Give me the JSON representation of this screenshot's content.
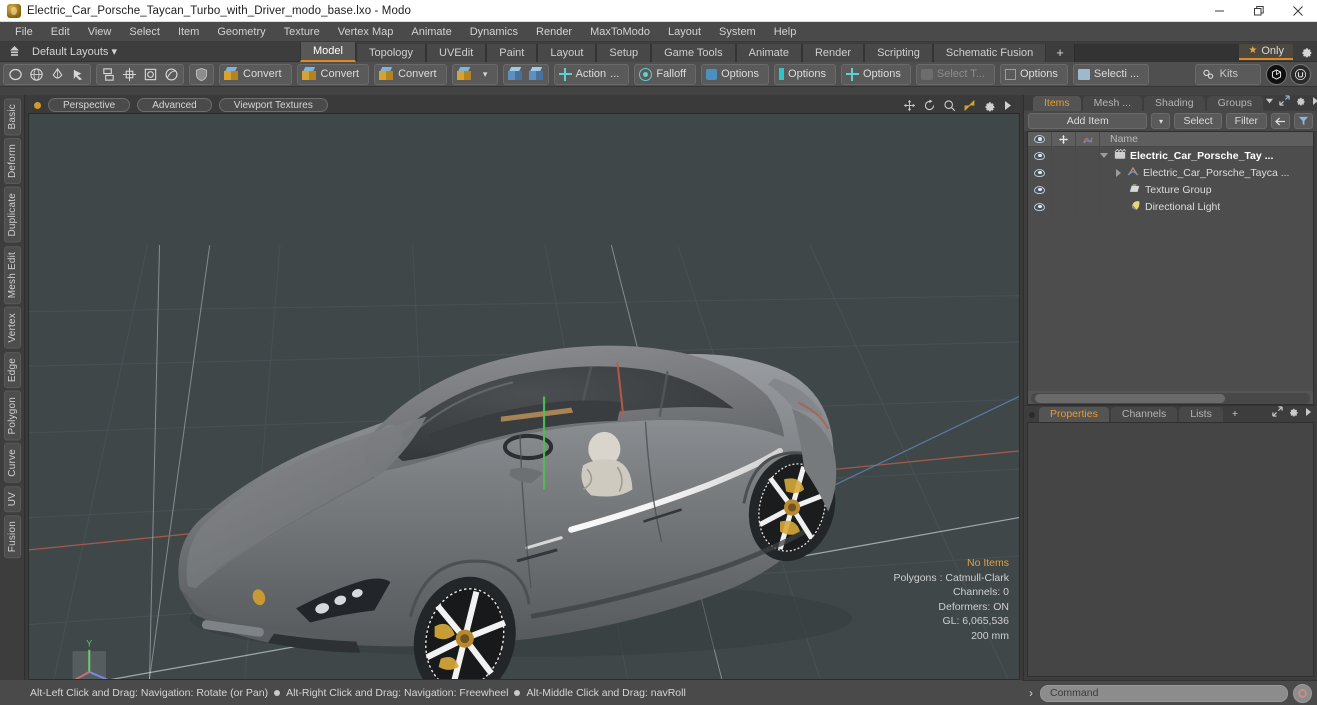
{
  "window": {
    "title": "Electric_Car_Porsche_Taycan_Turbo_with_Driver_modo_base.lxo - Modo",
    "app_icon": "modo-app-icon",
    "minimize": "—",
    "maximize": "❐",
    "close": "✕"
  },
  "menubar": {
    "items": [
      {
        "label": "File"
      },
      {
        "label": "Edit"
      },
      {
        "label": "View"
      },
      {
        "label": "Select"
      },
      {
        "label": "Item"
      },
      {
        "label": "Geometry"
      },
      {
        "label": "Texture"
      },
      {
        "label": "Vertex Map"
      },
      {
        "label": "Animate"
      },
      {
        "label": "Dynamics"
      },
      {
        "label": "Render"
      },
      {
        "label": "MaxToModo"
      },
      {
        "label": "Layout"
      },
      {
        "label": "System"
      },
      {
        "label": "Help"
      }
    ]
  },
  "layoutbar": {
    "home_icon": "home-layout-icon",
    "dropdown_label": "Default Layouts",
    "dropdown_caret": "▾",
    "tabs": [
      {
        "label": "Model",
        "active": true
      },
      {
        "label": "Topology",
        "active": false
      },
      {
        "label": "UVEdit",
        "active": false
      },
      {
        "label": "Paint",
        "active": false
      },
      {
        "label": "Layout",
        "active": false
      },
      {
        "label": "Setup",
        "active": false
      },
      {
        "label": "Game Tools",
        "active": false
      },
      {
        "label": "Animate",
        "active": false
      },
      {
        "label": "Render",
        "active": false
      },
      {
        "label": "Scripting",
        "active": false
      },
      {
        "label": "Schematic Fusion",
        "active": false
      }
    ],
    "add_tab": "+",
    "only_label": "Only",
    "only_star": "★",
    "settings_icon": "gear-icon"
  },
  "toolbar": {
    "primitives": [
      {
        "name": "ellipsoid-tool"
      },
      {
        "name": "sphere-tool"
      },
      {
        "name": "teardrop-tool"
      },
      {
        "name": "pen-tool"
      }
    ],
    "mesh_ops": [
      {
        "name": "duplicate-tool"
      },
      {
        "name": "mirror-tool"
      },
      {
        "name": "bevel-tool"
      },
      {
        "name": "smooth-tool"
      }
    ],
    "shield_icon": "shield-icon",
    "convert_buttons": [
      {
        "label": "Convert",
        "name": "convert-mesh-button"
      },
      {
        "label": "Convert",
        "name": "convert-static-mesh-button"
      },
      {
        "label": "Convert",
        "name": "convert-procedural-button"
      }
    ],
    "convert_dropdown_caret": "▾",
    "action_label": "Action",
    "action_ellipsis": "...",
    "falloff_label": "Falloff",
    "options_buttons": [
      {
        "label": "Options",
        "name": "snapping-options-button",
        "dim": false
      },
      {
        "label": "Options",
        "name": "workplane-options-button",
        "dim": false
      },
      {
        "label": "Options",
        "name": "symmetry-options-button",
        "dim": false
      },
      {
        "label": "Select T...",
        "name": "select-through-button",
        "dim": true
      },
      {
        "label": "Options",
        "name": "element-options-button",
        "dim": false
      },
      {
        "label": "Selecti ...",
        "name": "selection-sets-button",
        "dim": false
      }
    ],
    "kits_label": "Kits",
    "kits_icon": "kits-gear-icon",
    "right_buttons": [
      {
        "name": "modo-bake-icon"
      },
      {
        "name": "unreal-engine-icon"
      }
    ]
  },
  "left_tabs": {
    "items": [
      {
        "label": "Basic"
      },
      {
        "label": "Deform"
      },
      {
        "label": "Duplicate"
      },
      {
        "label": "Mesh Edit"
      },
      {
        "label": "Vertex"
      },
      {
        "label": "Edge"
      },
      {
        "label": "Polygon"
      },
      {
        "label": "Curve"
      },
      {
        "label": "UV"
      },
      {
        "label": "Fusion"
      }
    ]
  },
  "viewport": {
    "dot": "active-viewport-dot",
    "pills": [
      {
        "label": "Perspective",
        "name": "viewport-projection-dropdown"
      },
      {
        "label": "Advanced",
        "name": "viewport-shading-dropdown"
      },
      {
        "label": "Viewport Textures",
        "name": "viewport-textures-dropdown"
      }
    ],
    "tool_icons": [
      {
        "name": "pan-icon"
      },
      {
        "name": "rotate-icon"
      },
      {
        "name": "zoom-icon"
      },
      {
        "name": "fit-icon"
      },
      {
        "name": "viewport-settings-gear-icon"
      },
      {
        "name": "viewport-expand-arrow-icon"
      }
    ],
    "info": {
      "no_items": "No Items",
      "polygons": "Polygons : Catmull-Clark",
      "channels": "Channels: 0",
      "deformers": "Deformers: ON",
      "gl": "GL: 6,065,536",
      "scale": "200 mm"
    },
    "axis_gizmo": "xyz-axis-gizmo",
    "background_color": "#3f4749"
  },
  "statusbar": {
    "hint1": "Alt-Left Click and Drag: Navigation: Rotate (or Pan)",
    "hint2": "Alt-Right Click and Drag: Navigation: Freewheel",
    "hint3": "Alt-Middle Click and Drag: navRoll"
  },
  "right_panel": {
    "tabs": [
      {
        "label": "Items",
        "active": true
      },
      {
        "label": "Mesh ...",
        "active": false
      },
      {
        "label": "Shading",
        "active": false
      },
      {
        "label": "Groups",
        "active": false
      }
    ],
    "tab_tools": [
      {
        "name": "panel-caret-down-icon"
      },
      {
        "name": "panel-popout-icon"
      },
      {
        "name": "panel-gear-icon"
      },
      {
        "name": "panel-arrow-right-icon"
      }
    ],
    "list_toolbar": {
      "add_item": "Add Item",
      "add_item_caret": "▾",
      "select": "Select",
      "filter": "Filter",
      "back_icon": "arrow-left-icon",
      "funnel_icon": "funnel-filter-icon"
    },
    "list_headers": {
      "visibility_icon": "eye-icon",
      "lock_icon": "lock-move-icon",
      "shading_icon": "shading-swatch-icon",
      "name": "Name"
    },
    "items": [
      {
        "label": "Electric_Car_Porsche_Tay ...",
        "icon": "scene-icon",
        "depth": 0,
        "expanded": true,
        "root": true
      },
      {
        "label": "Electric_Car_Porsche_Tayca ...",
        "icon": "mesh-icon",
        "depth": 1,
        "expanded": false,
        "root": false
      },
      {
        "label": "Texture Group",
        "icon": "texture-group-icon",
        "depth": 1,
        "expanded": null,
        "root": false
      },
      {
        "label": "Directional Light",
        "icon": "directional-light-icon",
        "depth": 1,
        "expanded": null,
        "root": false
      }
    ],
    "props_tabs": [
      {
        "label": "Properties",
        "active": true
      },
      {
        "label": "Channels",
        "active": false
      },
      {
        "label": "Lists",
        "active": false
      },
      {
        "label": "+",
        "active": false
      }
    ],
    "props_tools": [
      {
        "name": "props-popout-icon"
      },
      {
        "name": "props-gear-icon"
      },
      {
        "name": "props-arrow-right-icon"
      }
    ]
  },
  "command_bar": {
    "prompt": "›",
    "placeholder": "Command",
    "record_icon": "record-macro-icon"
  }
}
